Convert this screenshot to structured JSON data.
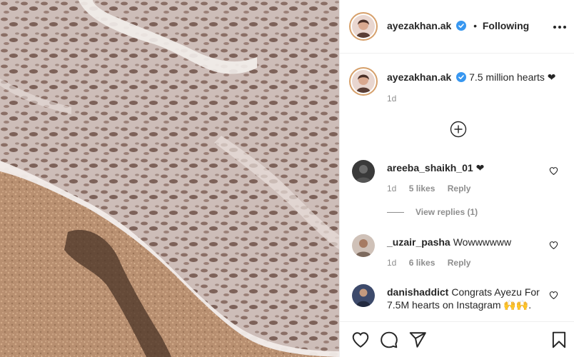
{
  "header": {
    "username": "ayezakhan.ak",
    "separator": "•",
    "follow_status": "Following"
  },
  "caption": {
    "username": "ayezakhan.ak",
    "text": "7.5 million hearts ❤",
    "time": "1d"
  },
  "comments": [
    {
      "username": "areeba_shaikh_01",
      "text": "❤",
      "time": "1d",
      "likes": "5 likes",
      "reply": "Reply",
      "view_replies": "View replies (1)"
    },
    {
      "username": "_uzair_pasha",
      "text": "Wowwwwww",
      "time": "1d",
      "likes": "6 likes",
      "reply": "Reply"
    },
    {
      "username": "danishaddict",
      "text": "Congrats Ayezu For 7.5M hearts on Instagram 🙌🙌."
    }
  ],
  "icons": {
    "verified": "verified-badge-icon",
    "more": "more-options-icon",
    "load_more": "plus-circle-icon",
    "like": "heart-outline-icon",
    "comment": "speech-bubble-icon",
    "share": "paper-plane-icon",
    "save": "bookmark-icon"
  },
  "colors": {
    "verified_blue": "#3897f0",
    "text_primary": "#262626",
    "text_secondary": "#8e8e8e",
    "divider": "#efefef"
  }
}
